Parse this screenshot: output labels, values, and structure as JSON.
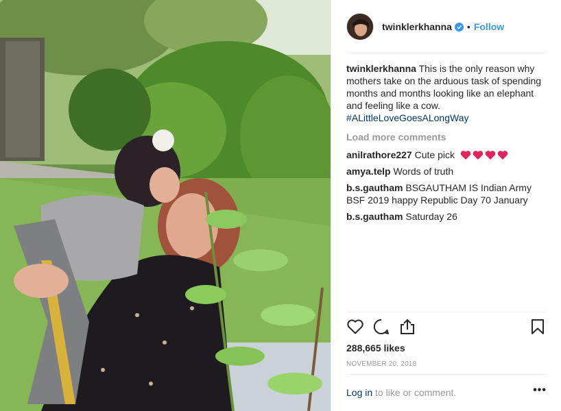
{
  "post": {
    "author": "twinklerkhanna",
    "follow_label": "Follow",
    "separator": "•",
    "caption_text": "This is the only reason why mothers take on the arduous task of spending months and months looking like an elephant and feeling like a cow.",
    "hashtag": "#ALittleLoveGoesALongWay",
    "load_more": "Load more comments",
    "comments": [
      {
        "user": "anilrathore227",
        "text": "Cute pick",
        "hearts": 4
      },
      {
        "user": "amya.telp",
        "text": "Words of truth"
      },
      {
        "user": "b.s.gautham",
        "text": "BSGAUTHAM IS Indian Army BSF 2019 happy Republic Day 70 January"
      },
      {
        "user": "b.s.gautham",
        "text": "Saturday 26"
      }
    ],
    "likes": "288,665 likes",
    "date": "NOVEMBER 20, 2018",
    "login_link": "Log in",
    "login_suffix": " to like or comment.",
    "more_options": "•••"
  },
  "icons": {
    "verified": "verified-badge-icon",
    "like": "heart-icon",
    "comment": "comment-icon",
    "share": "share-icon",
    "save": "bookmark-icon"
  },
  "colors": {
    "link_blue": "#3897f0",
    "hashtag": "#003569",
    "muted": "#999999",
    "heart_red": "#e0245e"
  }
}
